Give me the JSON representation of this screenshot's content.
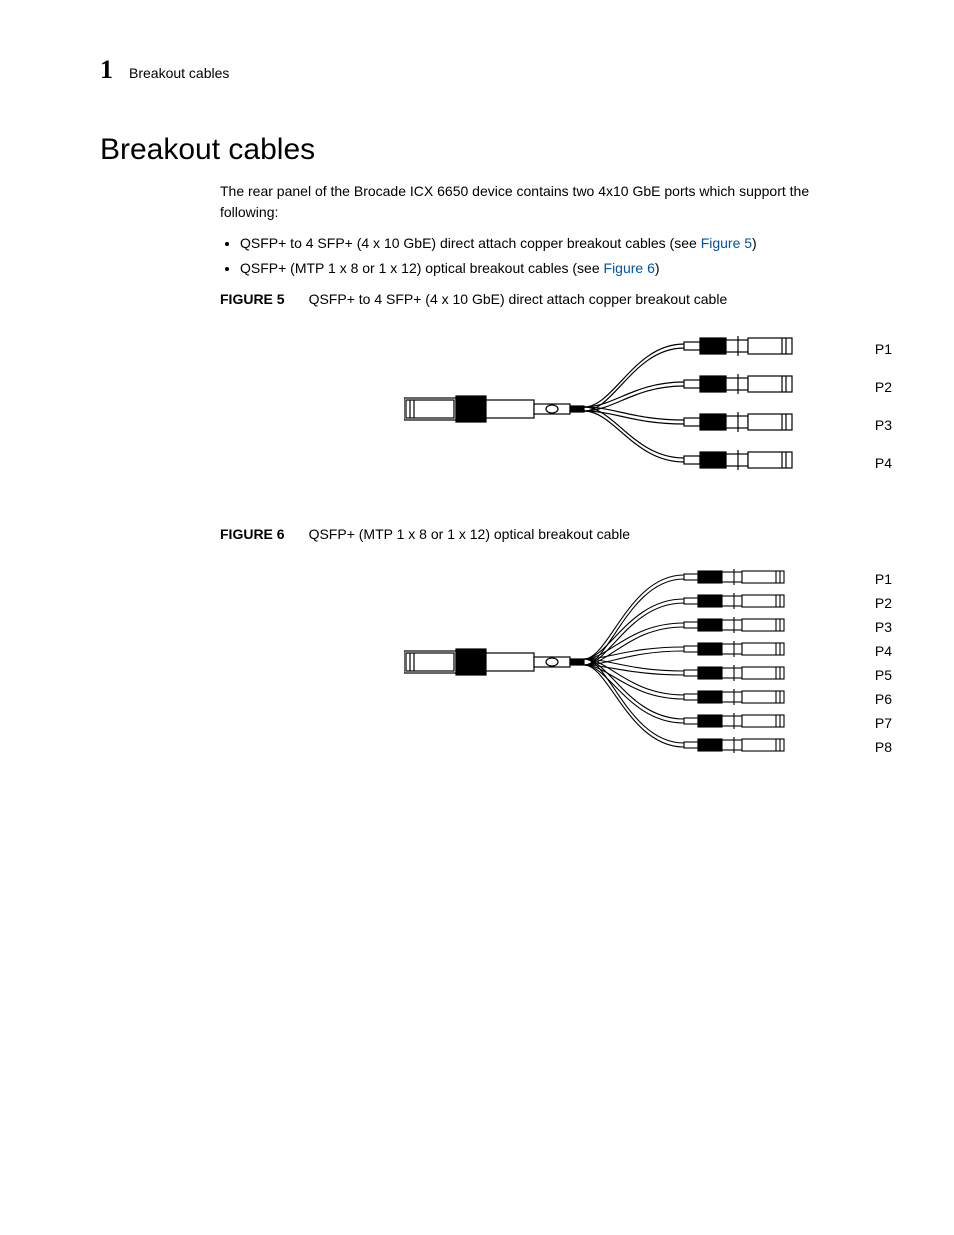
{
  "header": {
    "chapter_number": "1",
    "running_title": "Breakout cables"
  },
  "section": {
    "title": "Breakout cables",
    "intro": "The rear panel of the Brocade ICX 6650 device contains two 4x10 GbE ports which support the following:",
    "bullets": [
      {
        "text_before_link": "QSFP+ to 4 SFP+ (4 x 10 GbE) direct attach copper breakout cables (see ",
        "link_text": "Figure 5",
        "text_after_link": ")"
      },
      {
        "text_before_link": "QSFP+ (MTP 1 x 8 or 1 x 12) optical breakout cables (see ",
        "link_text": "Figure 6",
        "text_after_link": ")"
      }
    ]
  },
  "figures": [
    {
      "label": "FIGURE 5",
      "caption": "QSFP+ to 4 SFP+ (4 x 10 GbE) direct attach copper breakout cable",
      "ports": [
        "P1",
        "P2",
        "P3",
        "P4"
      ]
    },
    {
      "label": "FIGURE 6",
      "caption": "QSFP+ (MTP 1 x 8 or 1 x 12) optical breakout cable",
      "ports": [
        "P1",
        "P2",
        "P3",
        "P4",
        "P5",
        "P6",
        "P7",
        "P8"
      ]
    }
  ]
}
